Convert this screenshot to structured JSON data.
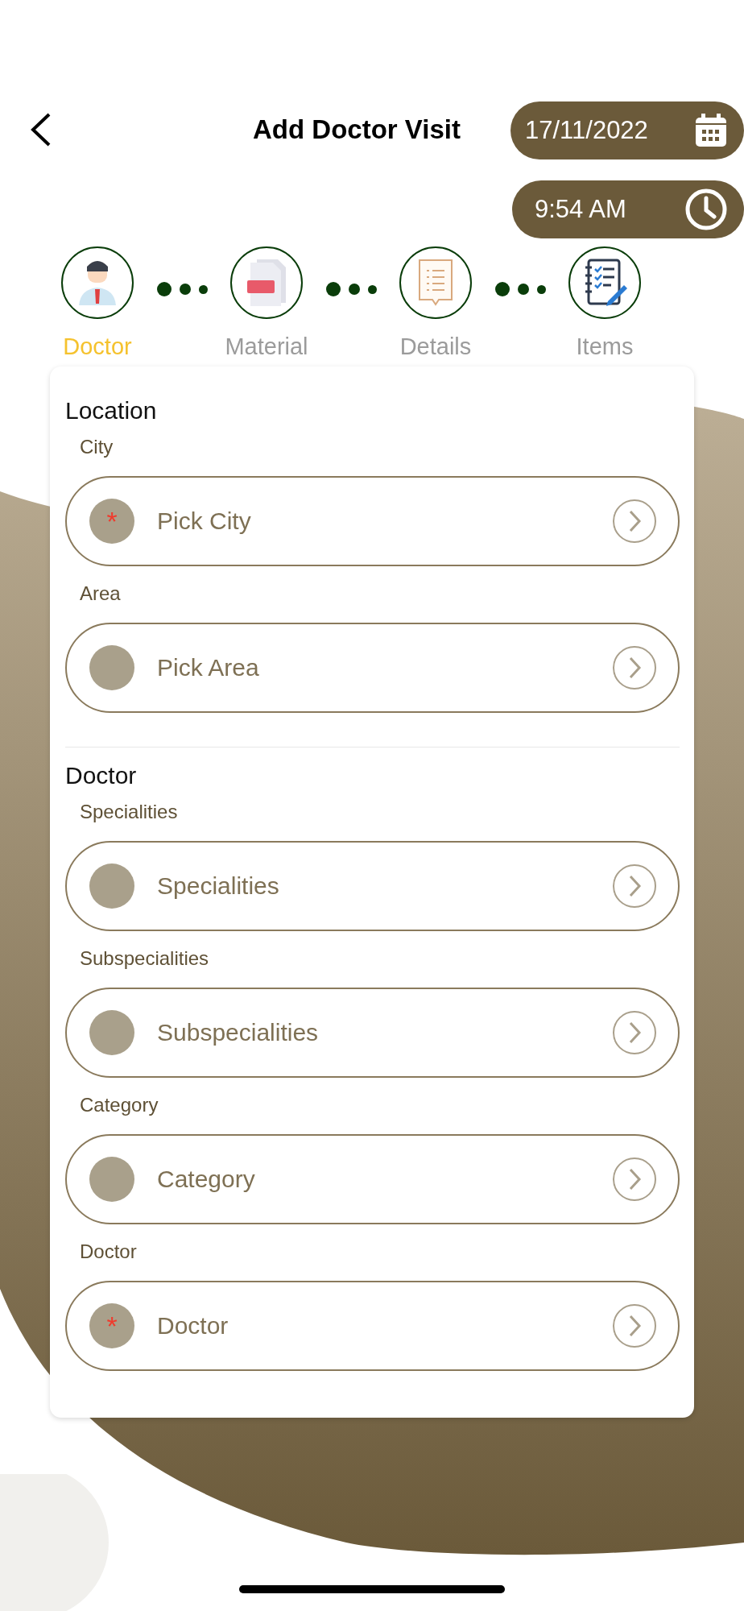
{
  "header": {
    "title": "Add Doctor Visit",
    "date": "17/11/2022",
    "time": "9:54 AM"
  },
  "steps": [
    {
      "label": "Doctor",
      "selected": true,
      "kind": "doctor"
    },
    {
      "label": "Material",
      "selected": false,
      "kind": "pdf"
    },
    {
      "label": "Details",
      "selected": false,
      "kind": "details"
    },
    {
      "label": "Items",
      "selected": false,
      "kind": "items"
    }
  ],
  "sections": [
    {
      "title": "Location",
      "fields": [
        {
          "label": "City",
          "placeholder": "Pick City",
          "marker": "*"
        },
        {
          "label": "Area",
          "placeholder": "Pick Area"
        }
      ]
    },
    {
      "title": "Doctor",
      "fields": [
        {
          "label": "Specialities",
          "placeholder": "Specialities"
        },
        {
          "label": "Subspecialities",
          "placeholder": "Subspecialities"
        },
        {
          "label": "Category",
          "placeholder": "Category"
        },
        {
          "label": "Doctor",
          "placeholder": "Doctor",
          "marker": "*"
        }
      ]
    }
  ]
}
